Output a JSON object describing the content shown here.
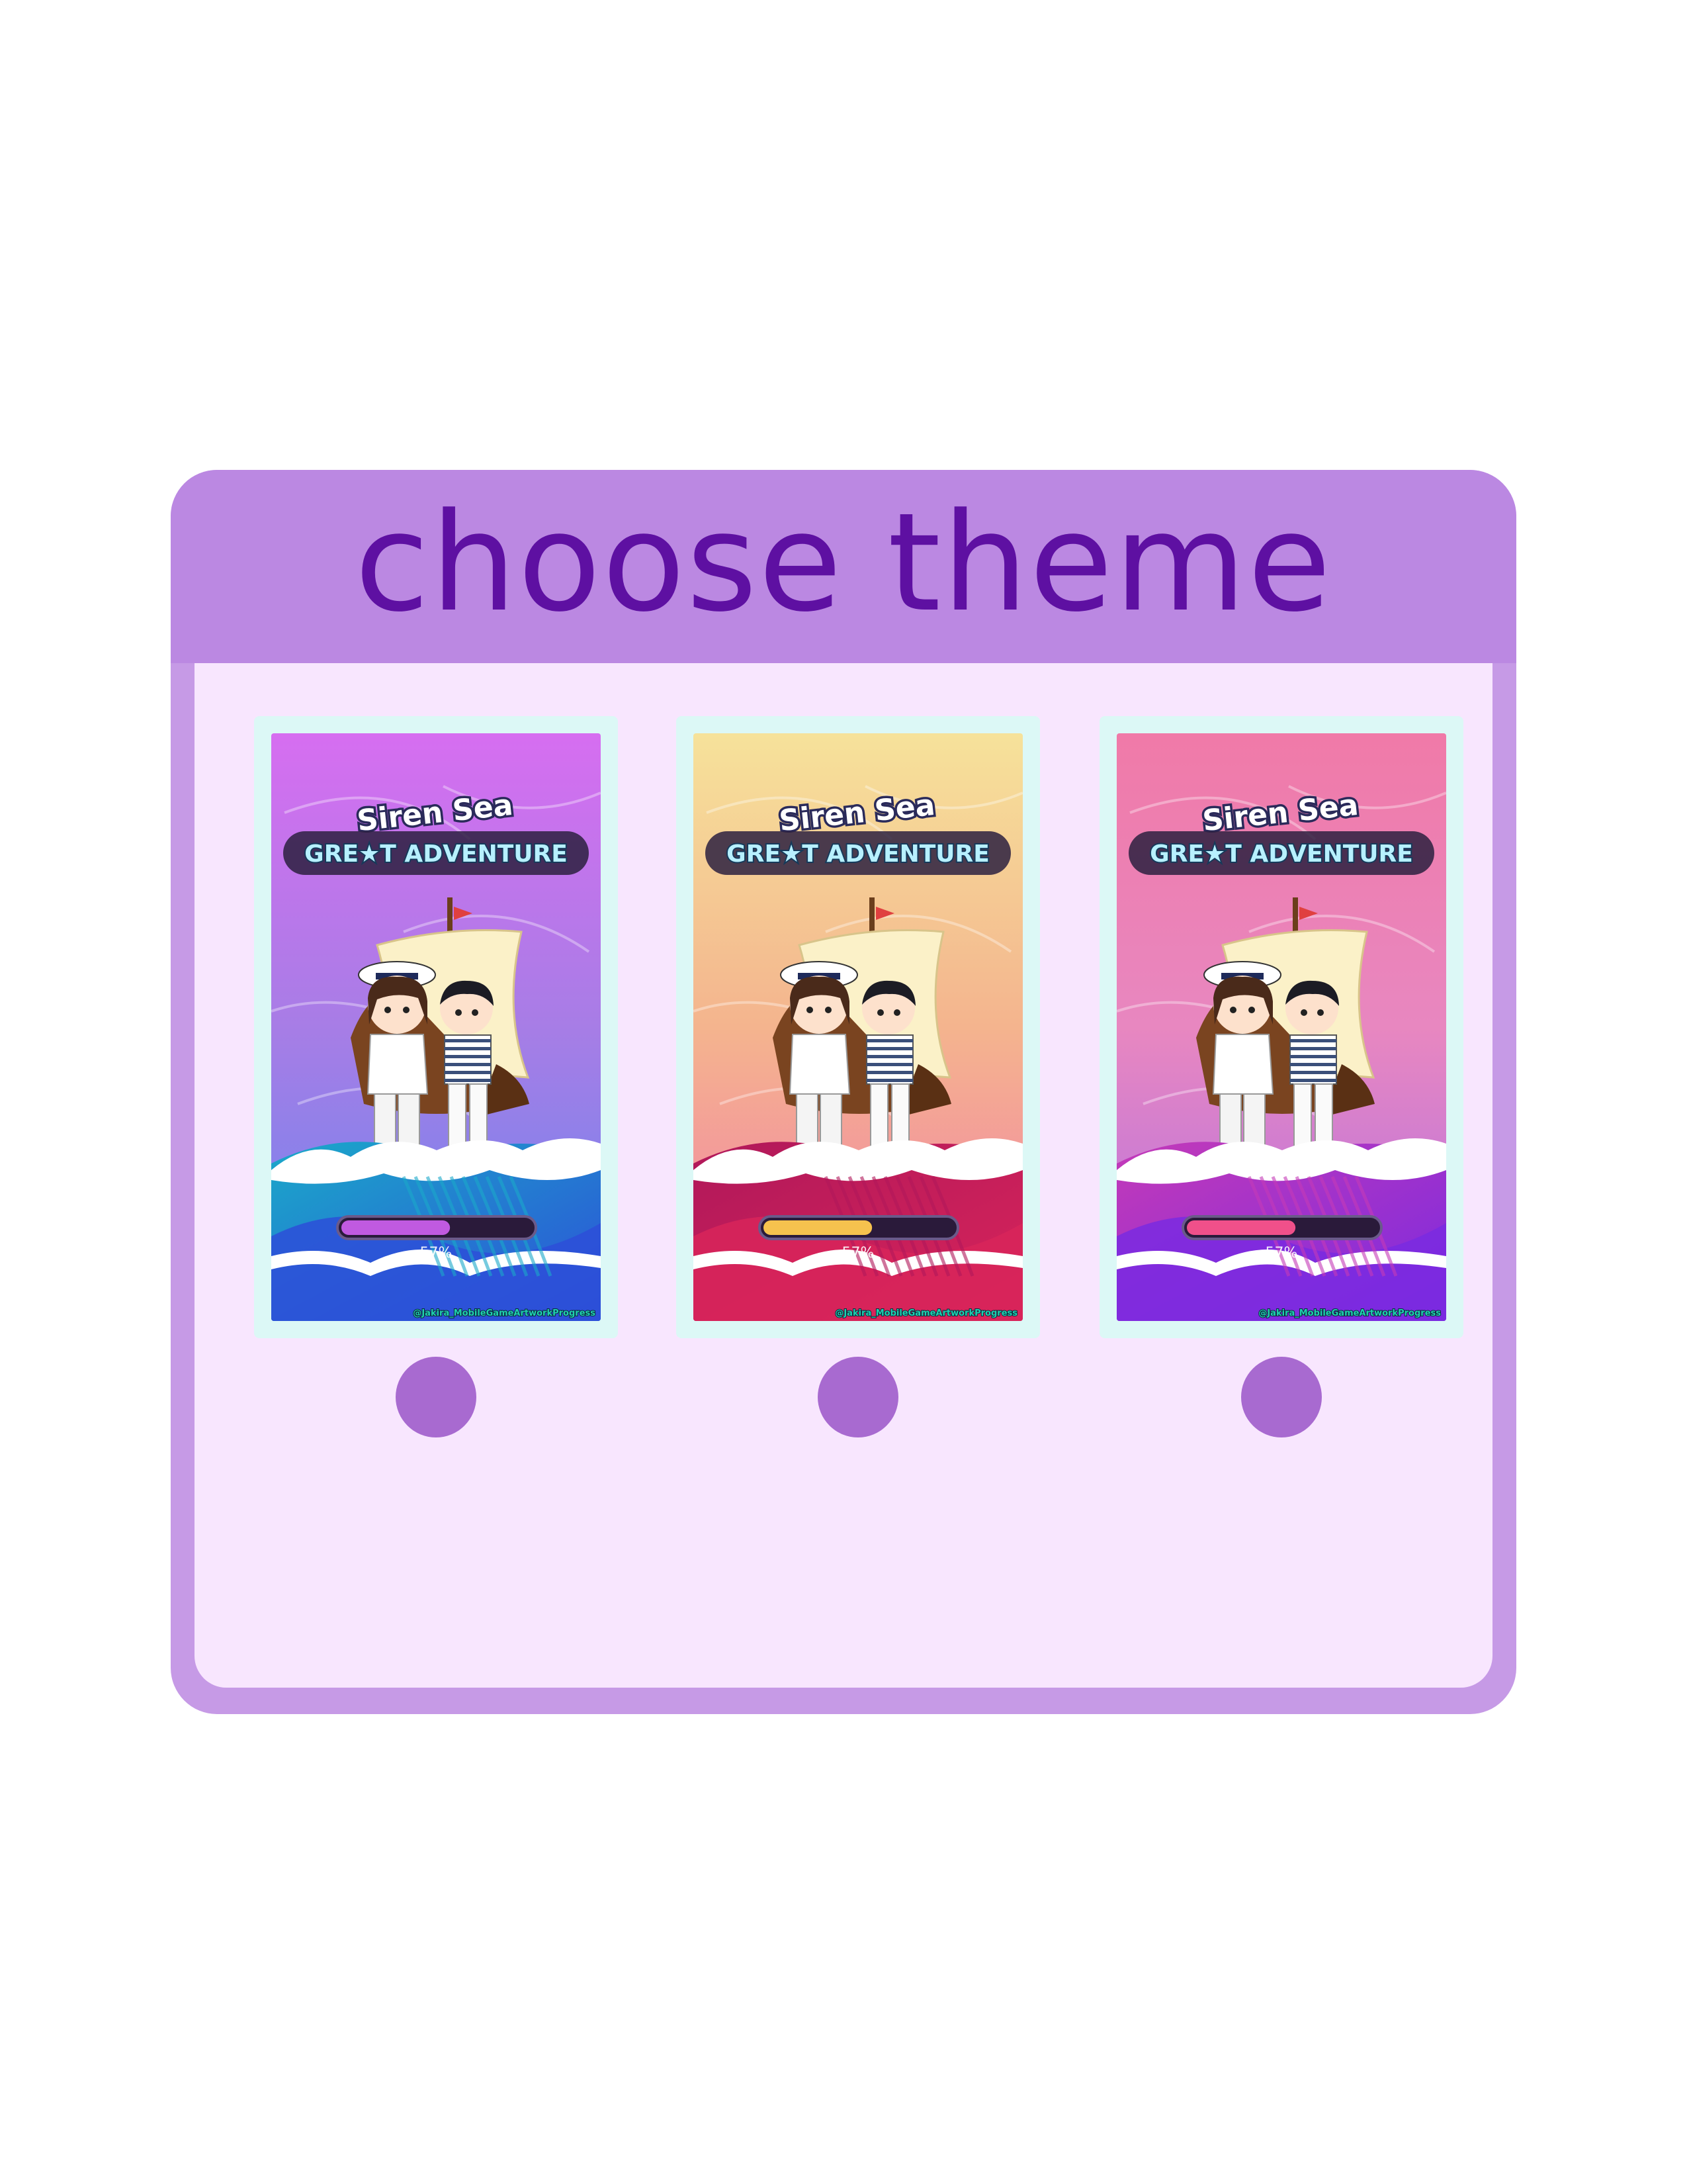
{
  "panel": {
    "title": "choose theme"
  },
  "themes": [
    {
      "id": "purple",
      "game_title_line1": "Siren Sea",
      "game_title_line2": "GRE★T ADVENTURE",
      "progress_percent": 57,
      "progress_label": "57%",
      "watermark": "@Jakira_MobileGameArtworkProgress",
      "colors": {
        "bg_top": "#d66ef0",
        "bg_mid": "#a77de6",
        "bg_bottom": "#6a86ee",
        "wave": "#2d4fd8",
        "wave2": "#1aa9c9",
        "bar_fill": "#c05ae0"
      }
    },
    {
      "id": "sunset",
      "game_title_line1": "Siren Sea",
      "game_title_line2": "GRE★T ADVENTURE",
      "progress_percent": 57,
      "progress_label": "57%",
      "watermark": "@Jakira_MobileGameArtworkProgress",
      "colors": {
        "bg_top": "#f6e29a",
        "bg_mid": "#f4b48e",
        "bg_bottom": "#f27ca8",
        "wave": "#d8245a",
        "wave2": "#b0185a",
        "bar_fill": "#f6c24e"
      }
    },
    {
      "id": "pink",
      "game_title_line1": "Siren Sea",
      "game_title_line2": "GRE★T ADVENTURE",
      "progress_percent": 57,
      "progress_label": "57%",
      "watermark": "@Jakira_MobileGameArtworkProgress",
      "colors": {
        "bg_top": "#f07aa8",
        "bg_mid": "#e887c0",
        "bg_bottom": "#b070e6",
        "wave": "#7a2ae0",
        "wave2": "#c43ab8",
        "bar_fill": "#f0508a"
      }
    }
  ]
}
